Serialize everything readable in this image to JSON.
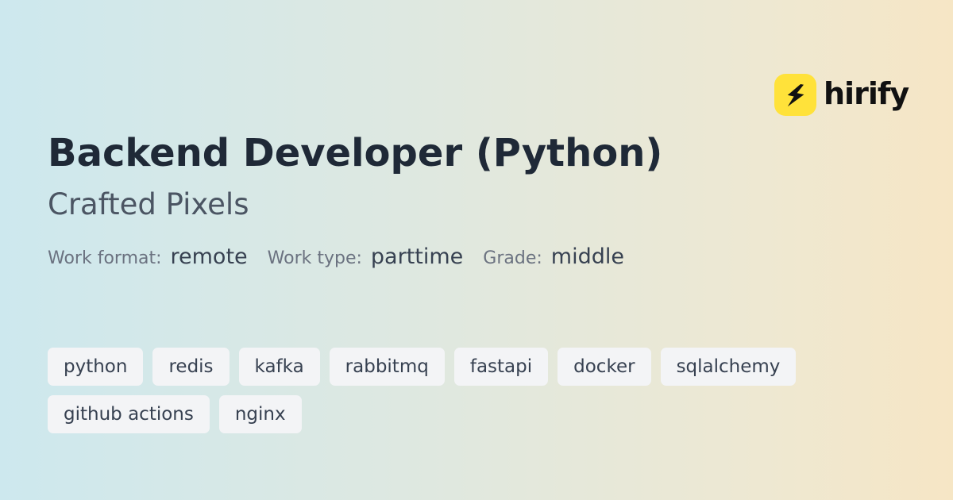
{
  "brand": {
    "name": "hirify",
    "icon": "lightning-bolt-icon",
    "badge_color": "#ffe23a"
  },
  "job": {
    "title": "Backend Developer (Python)",
    "company": "Crafted Pixels"
  },
  "meta": [
    {
      "label": "Work format:",
      "value": "remote"
    },
    {
      "label": "Work type:",
      "value": "parttime"
    },
    {
      "label": "Grade:",
      "value": "middle"
    }
  ],
  "tags": [
    "python",
    "redis",
    "kafka",
    "rabbitmq",
    "fastapi",
    "docker",
    "sqlalchemy",
    "github actions",
    "nginx"
  ],
  "colors": {
    "gradient_start": "#cde8ee",
    "gradient_end": "#f6e6c5",
    "title": "#1f2937",
    "tag_bg": "#f3f4f6"
  }
}
